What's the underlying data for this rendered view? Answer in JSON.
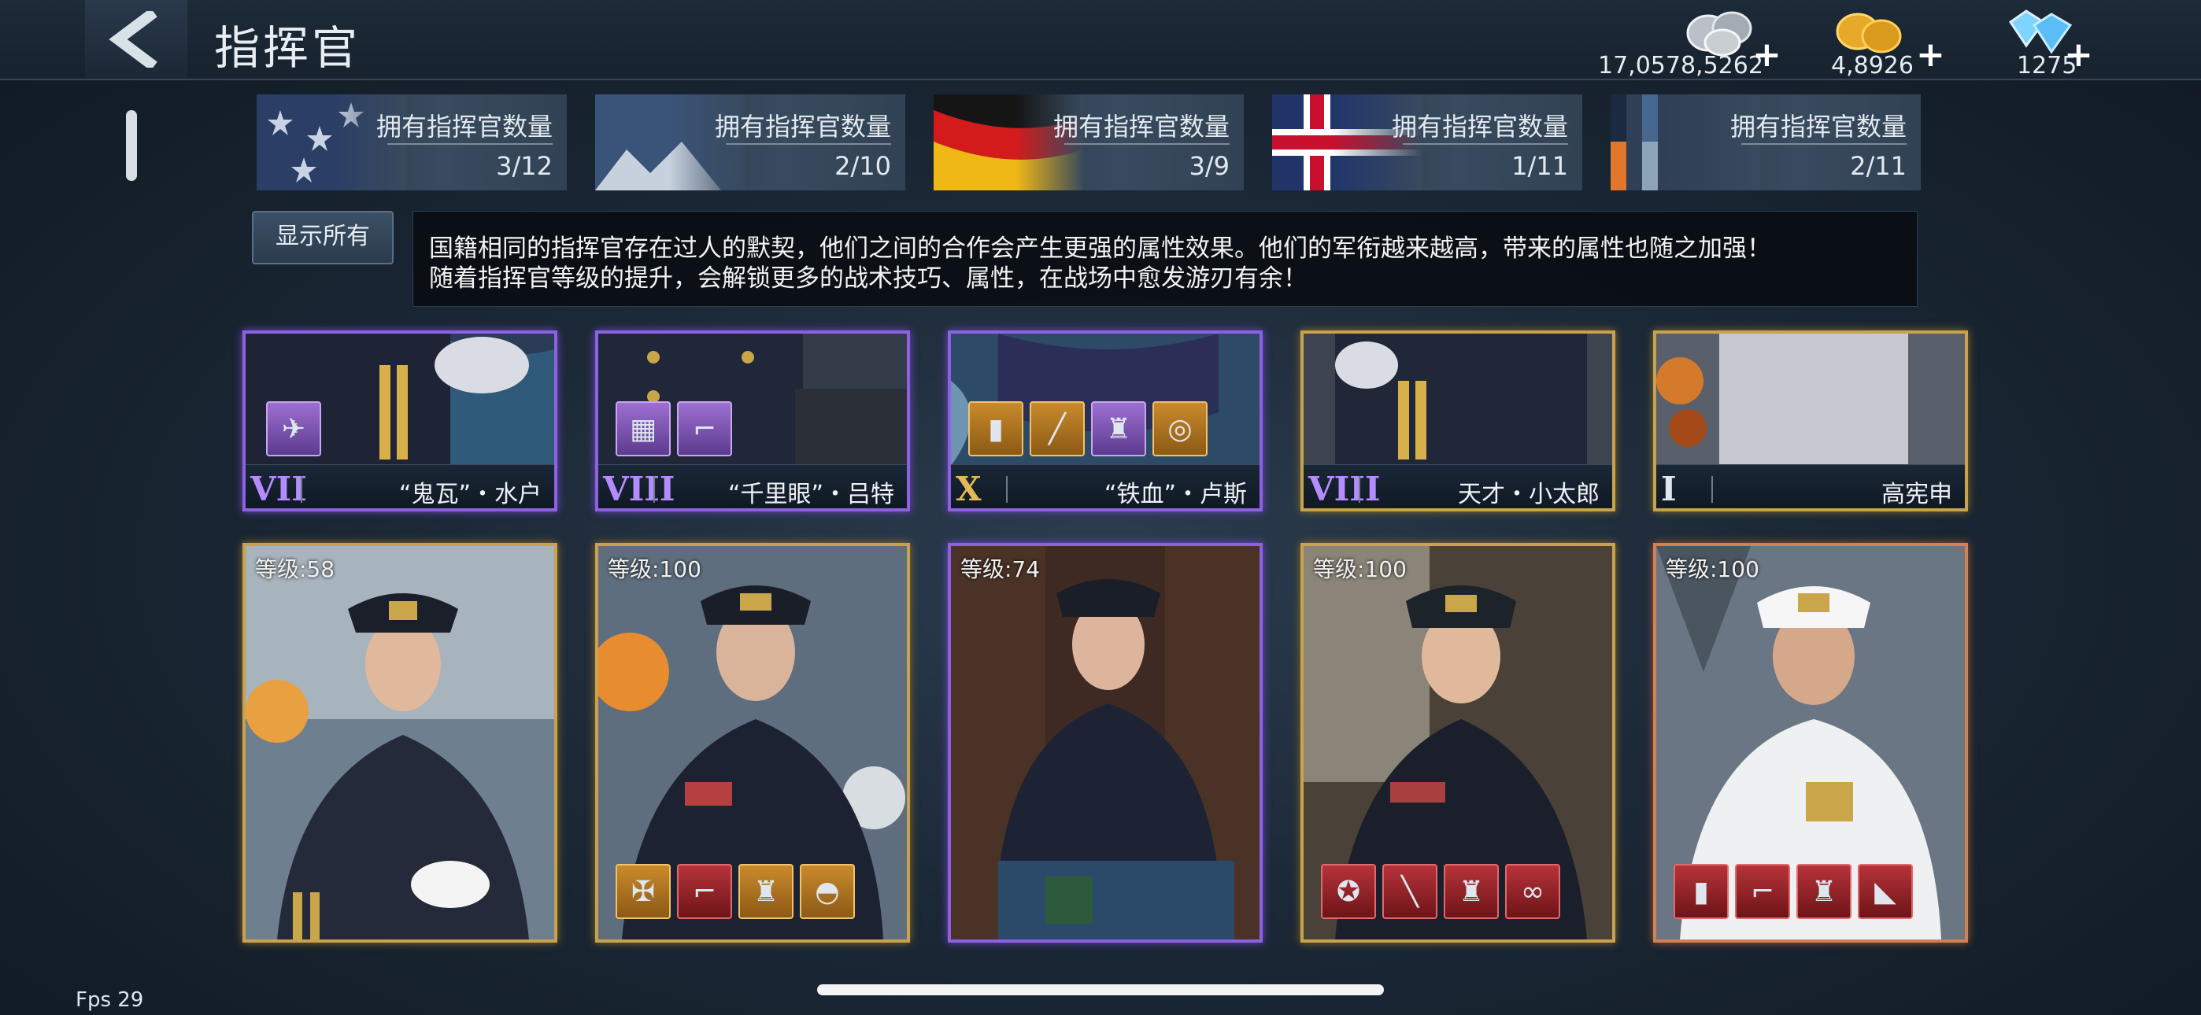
{
  "header": {
    "title": "指挥官",
    "currencies": [
      {
        "icon": "silver-coins-icon",
        "amount": "17,0578,5262"
      },
      {
        "icon": "gold-coins-icon",
        "amount": "4,8926"
      },
      {
        "icon": "diamond-icon",
        "amount": "1275"
      }
    ],
    "plus": "+"
  },
  "nations": [
    {
      "flag": "usa-flag",
      "label": "拥有指挥官数量",
      "count": "3/12"
    },
    {
      "flag": "japan-flag",
      "label": "拥有指挥官数量",
      "count": "2/10"
    },
    {
      "flag": "germany-flag",
      "label": "拥有指挥官数量",
      "count": "3/9"
    },
    {
      "flag": "uk-flag",
      "label": "拥有指挥官数量",
      "count": "1/11"
    },
    {
      "flag": "other-flag",
      "label": "拥有指挥官数量",
      "count": "2/11"
    }
  ],
  "show_all_label": "显示所有",
  "info_text": {
    "line1": "国籍相同的指挥官存在过人的默契，他们之间的合作会产生更强的属性效果。他们的军衔越来越高，带来的属性也随之加强！",
    "line2": "随着指挥官等级的提升，会解锁更多的战术技巧、属性，在战场中愈发游刃有余！"
  },
  "top_row": [
    {
      "rank": "VII",
      "name": "“鬼瓦”・水户",
      "frame": "purple",
      "equipment": [
        "wings-icon"
      ]
    },
    {
      "rank": "VIII",
      "name": "“千里眼”・吕特",
      "frame": "purple",
      "equipment": [
        "ribbons-icon",
        "pistol-icon"
      ]
    },
    {
      "rank": "X",
      "name": "“铁血”・卢斯",
      "frame": "purple",
      "equipment": [
        "epaulette-icon",
        "baton-icon",
        "uniform-icon",
        "watch-icon"
      ]
    },
    {
      "rank": "VIII",
      "name": "天才・小太郎",
      "frame": "gold",
      "equipment": []
    },
    {
      "rank": "I",
      "name": "高宪申",
      "frame": "gold",
      "equipment": []
    }
  ],
  "bottom_row": [
    {
      "level": "等级:58",
      "frame": "gold",
      "equipment": []
    },
    {
      "level": "等级:100",
      "frame": "gold",
      "equipment": [
        "medal-icon",
        "pistol-icon",
        "uniform-icon",
        "cap-icon"
      ]
    },
    {
      "level": "等级:74",
      "frame": "purple",
      "equipment": []
    },
    {
      "level": "等级:100",
      "frame": "gold",
      "equipment": [
        "badge-icon",
        "rifle-icon",
        "uniform-icon",
        "binoculars-icon"
      ]
    },
    {
      "level": "等级:100",
      "frame": "orange",
      "equipment": [
        "epaulette-icon",
        "pistol-icon",
        "uniform-icon",
        "boots-icon"
      ]
    }
  ],
  "fps": "Fps 29"
}
